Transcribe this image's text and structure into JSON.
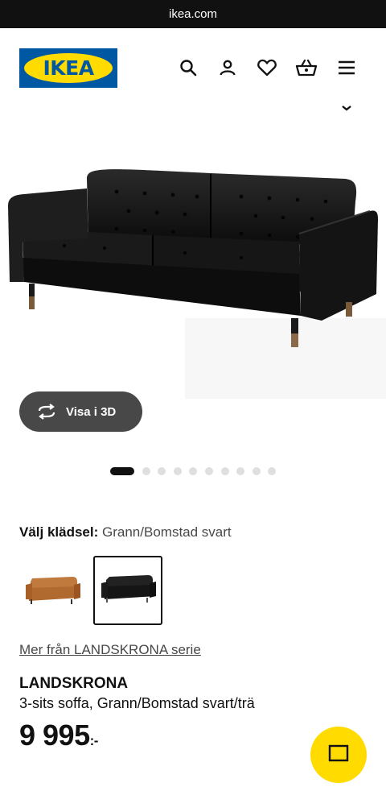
{
  "browser": {
    "url": "ikea.com"
  },
  "header": {
    "logo_text": "IKEA",
    "icons": [
      "search-icon",
      "profile-icon",
      "heart-icon",
      "basket-icon",
      "menu-icon"
    ]
  },
  "colors": {
    "brand_blue": "#0058a3",
    "brand_yellow": "#ffdb00",
    "button_dark": "#484848"
  },
  "hero": {
    "view_3d_label": "Visa i 3D",
    "carousel_count": 10,
    "carousel_active": 1
  },
  "upholstery": {
    "label": "Välj klädsel:",
    "value": "Grann/Bomstad svart",
    "options": [
      "Grann/Bomstad gyllenbrun",
      "Grann/Bomstad svart"
    ],
    "selected": 2
  },
  "series_link": "Mer från LANDSKRONA serie",
  "product": {
    "name": "LANDSKRONA",
    "description": "3-sits soffa, Grann/Bomstad svart/trä",
    "price": "9 995",
    "price_suffix": ":-"
  }
}
